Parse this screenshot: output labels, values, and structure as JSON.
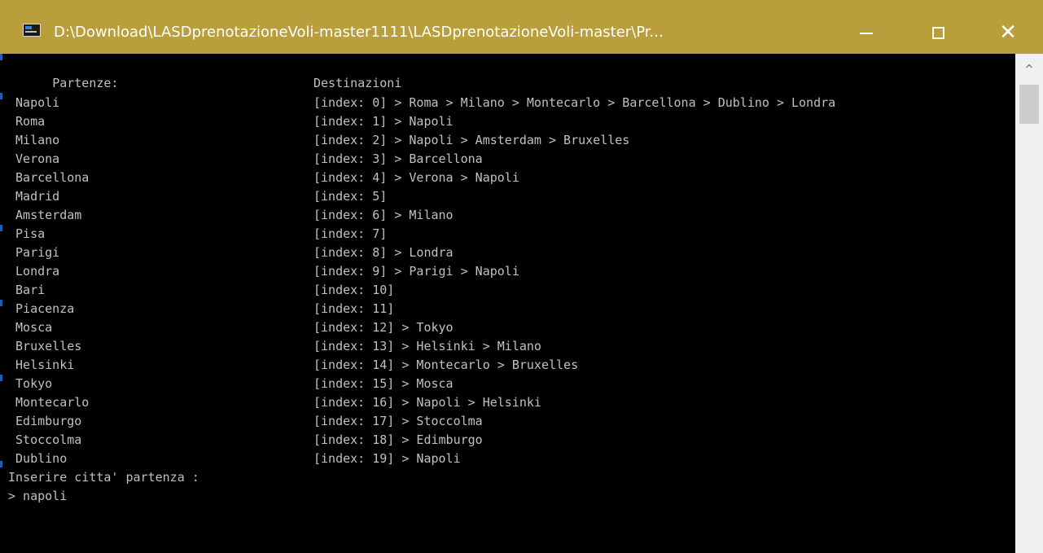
{
  "window": {
    "title": "D:\\Download\\LASDprenotazioneVoli-master1111\\LASDprenotazioneVoli-master\\Pr...",
    "minimize_label": "—",
    "maximize_label": "☐",
    "close_label": "✕"
  },
  "console": {
    "header_left": "Partenze:",
    "header_right": "Destinazioni",
    "rows": [
      {
        "city": " Napoli",
        "dest": "[index: 0] > Roma > Milano > Montecarlo > Barcellona > Dublino > Londra"
      },
      {
        "city": " Roma",
        "dest": "[index: 1] > Napoli"
      },
      {
        "city": " Milano",
        "dest": "[index: 2] > Napoli > Amsterdam > Bruxelles"
      },
      {
        "city": " Verona",
        "dest": "[index: 3] > Barcellona"
      },
      {
        "city": " Barcellona",
        "dest": "[index: 4] > Verona > Napoli"
      },
      {
        "city": " Madrid",
        "dest": "[index: 5]"
      },
      {
        "city": " Amsterdam",
        "dest": "[index: 6] > Milano"
      },
      {
        "city": " Pisa",
        "dest": "[index: 7]"
      },
      {
        "city": " Parigi",
        "dest": "[index: 8] > Londra"
      },
      {
        "city": " Londra",
        "dest": "[index: 9] > Parigi > Napoli"
      },
      {
        "city": " Bari",
        "dest": "[index: 10]"
      },
      {
        "city": " Piacenza",
        "dest": "[index: 11]"
      },
      {
        "city": " Mosca",
        "dest": "[index: 12] > Tokyo"
      },
      {
        "city": " Bruxelles",
        "dest": "[index: 13] > Helsinki > Milano"
      },
      {
        "city": " Helsinki",
        "dest": "[index: 14] > Montecarlo > Bruxelles"
      },
      {
        "city": " Tokyo",
        "dest": "[index: 15] > Mosca"
      },
      {
        "city": " Montecarlo",
        "dest": "[index: 16] > Napoli > Helsinki"
      },
      {
        "city": " Edimburgo",
        "dest": "[index: 17] > Stoccolma"
      },
      {
        "city": " Stoccolma",
        "dest": "[index: 18] > Edimburgo"
      },
      {
        "city": " Dublino",
        "dest": "[index: 19] > Napoli"
      }
    ],
    "prompt": "Inserire citta' partenza :",
    "input_line": "> napoli"
  },
  "colors": {
    "titlebar": "#b99f3c",
    "console_bg": "#000000",
    "console_text": "#c0c0c0",
    "scrollbar_track": "#f0f0f0",
    "scrollbar_thumb": "#cdcdcd"
  },
  "icons": {
    "app": "console-app-icon",
    "minimize": "minimize-icon",
    "maximize": "maximize-icon",
    "close": "close-icon",
    "scroll_up": "scroll-up-arrow-icon"
  }
}
